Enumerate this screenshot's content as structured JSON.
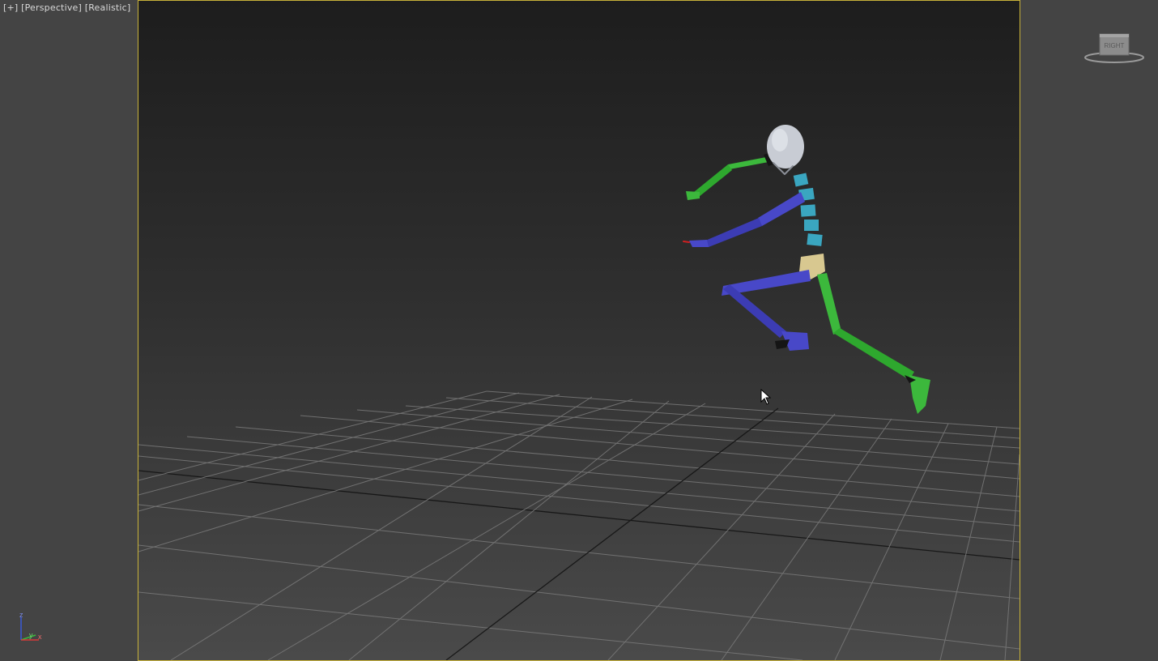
{
  "viewport": {
    "label_plus": "[+]",
    "label_view": "[Perspective]",
    "label_shading": "[Realistic]"
  },
  "viewcube": {
    "face_label": "RIGHT"
  },
  "axis_tripod": {
    "z": "z",
    "y": "y",
    "x": "x"
  },
  "colors": {
    "viewport_border": "#c8b23a",
    "left_limb": "#3cb83c",
    "right_limb": "#4848c8",
    "spine": "#3aa6c0",
    "pelvis": "#d8c890",
    "head": "#c8ccd4"
  },
  "icons": [
    "viewcube-icon",
    "axis-tripod-icon",
    "mouse-cursor-icon"
  ]
}
